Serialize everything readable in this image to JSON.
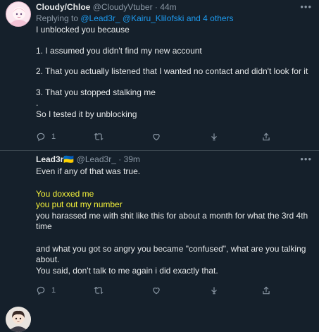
{
  "tweets": [
    {
      "name": "Cloudy/Chloe",
      "handle": "@CloudyVtuber",
      "dot": "·",
      "time": "44m",
      "more": "•••",
      "reply_prefix": "Replying to ",
      "reply_mentions": "@Lead3r_ @Kairu_Klilofski",
      "reply_suffix": " and 4 others",
      "lines": [
        "I unblocked you because",
        "",
        "1. I assumed you didn't find my new account",
        "",
        "2. That you actually listened that I wanted no contact and didn't look for it",
        "",
        "3. That you stopped stalking me",
        ".",
        "So I tested it by unblocking"
      ],
      "reply_count": "1"
    },
    {
      "name": "Lead3r",
      "flag": "🇺🇦",
      "handle": "@Lead3r_",
      "dot": "·",
      "time": "39m",
      "more": "•••",
      "lines": [
        "Even if any of that was true.",
        "",
        "You doxxed me",
        "you put out my number",
        "you harassed me with shit like this for about a month for what the 3rd 4th",
        "time",
        "",
        "and what you got so angry you became \"confused\", what are you talking",
        "about.",
        "You said, don't talk to me again i did exactly that."
      ],
      "highlighted_lines": [
        "You doxxed me",
        "you put out my number"
      ],
      "reply_count": "1"
    }
  ],
  "colors": {
    "background": "#15202b",
    "text": "#e7e9ea",
    "secondary": "#8b98a5",
    "link": "#1d9bf0",
    "highlight": "#f5f23a"
  },
  "icons": [
    "reply-icon",
    "retweet-icon",
    "like-icon",
    "download-icon",
    "share-icon",
    "more-icon"
  ]
}
